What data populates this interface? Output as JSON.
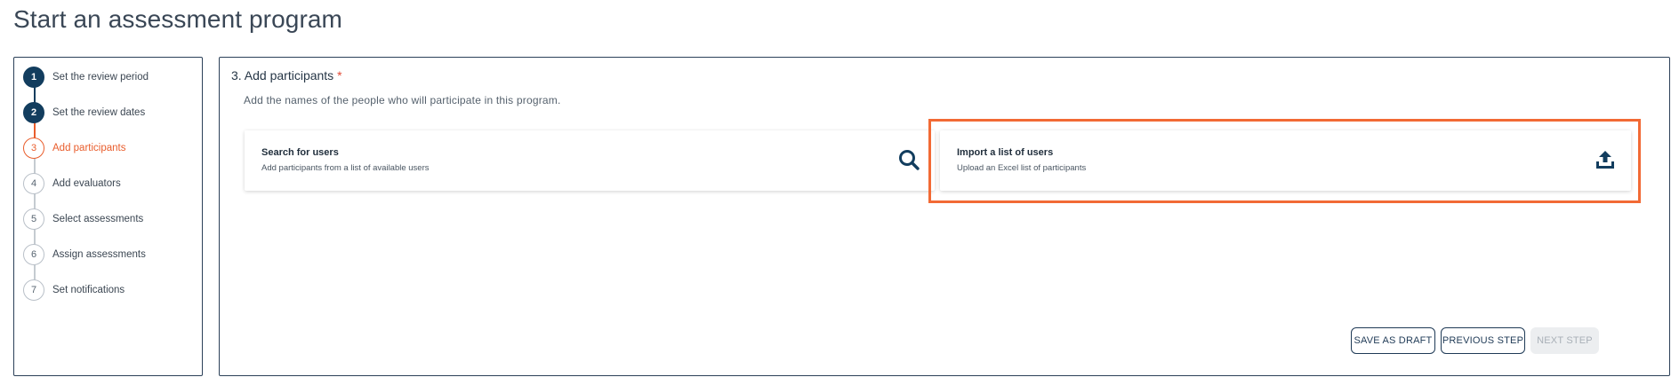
{
  "page": {
    "title": "Start an assessment program"
  },
  "stepper": {
    "steps": [
      {
        "number": "1",
        "label": "Set the review period",
        "state": "done"
      },
      {
        "number": "2",
        "label": "Set the review dates",
        "state": "done"
      },
      {
        "number": "3",
        "label": "Add participants",
        "state": "active"
      },
      {
        "number": "4",
        "label": "Add evaluators",
        "state": "todo"
      },
      {
        "number": "5",
        "label": "Select assessments",
        "state": "todo"
      },
      {
        "number": "6",
        "label": "Assign assessments",
        "state": "todo"
      },
      {
        "number": "7",
        "label": "Set notifications",
        "state": "todo"
      }
    ]
  },
  "section": {
    "title": "3. Add participants",
    "required_marker": "*",
    "description": "Add the names of the people who will participate in this program."
  },
  "cards": {
    "search": {
      "title": "Search for users",
      "subtitle": "Add participants from a list of available users",
      "icon": "search-icon"
    },
    "import": {
      "title": "Import a list of users",
      "subtitle": "Upload an Excel list of participants",
      "icon": "upload-icon"
    }
  },
  "actions": {
    "save_draft": "SAVE AS DRAFT",
    "previous": "PREVIOUS STEP",
    "next": "NEXT STEP",
    "next_disabled": true
  },
  "colors": {
    "primary": "#123d5e",
    "accent": "#e95d2c",
    "highlight": "#f26a35",
    "pending": "#b9c0c8"
  }
}
